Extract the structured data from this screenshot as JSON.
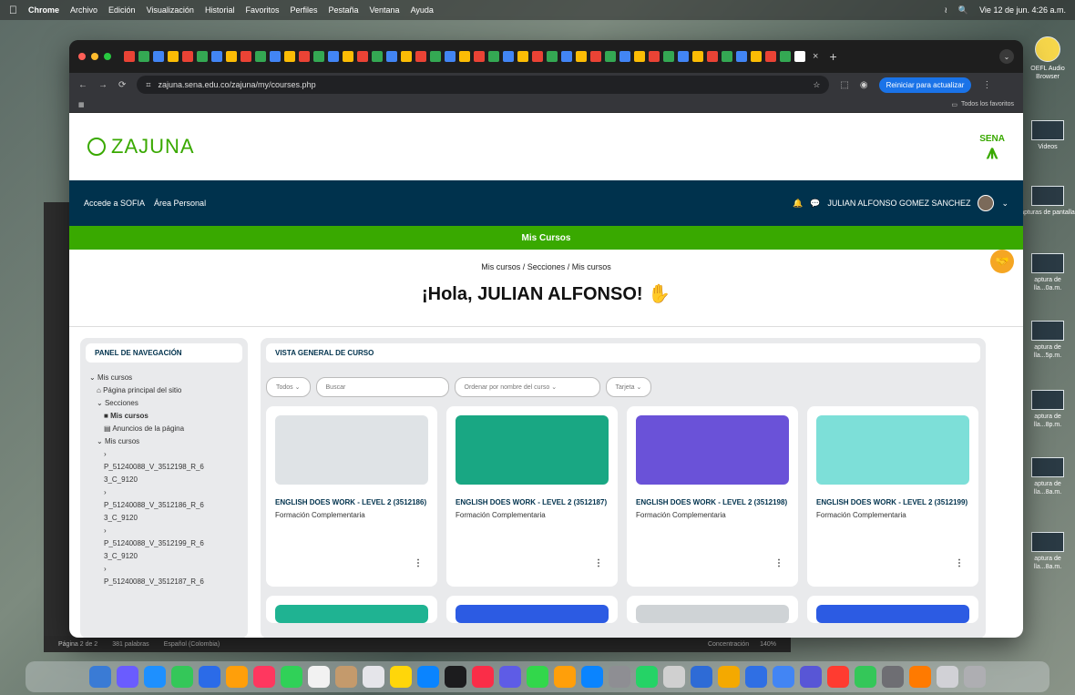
{
  "menubar": {
    "apple_icon": "apple-logo-icon",
    "items": [
      "Chrome",
      "Archivo",
      "Edición",
      "Visualización",
      "Historial",
      "Favoritos",
      "Perfiles",
      "Pestaña",
      "Ventana",
      "Ayuda"
    ],
    "datetime": "Vie 12 de jun. 4:26 a.m."
  },
  "desktop_icons": [
    {
      "label": "OEFL Audio\nBrowser"
    },
    {
      "label": "Videos"
    },
    {
      "label": "apturas de\npantalla"
    },
    {
      "label": "aptura de\nlla...0a.m."
    },
    {
      "label": "aptura de\nlla...5p.m."
    },
    {
      "label": "aptura de\nlla...8p.m."
    },
    {
      "label": "aptura de\nlla...8a.m."
    },
    {
      "label": "aptura de\nlla...8a.m."
    }
  ],
  "behind_window": {
    "status_left": "Página 2 de 2",
    "words": "381 palabras",
    "lang": "Español (Colombia)",
    "focus": "Concentración",
    "zoom": "140%"
  },
  "browser": {
    "url": "zajuna.sena.edu.co/zajuna/my/courses.php",
    "update_button": "Reiniciar para actualizar",
    "bookmarks_all": "Todos los favoritos",
    "accent": "#1a73e8"
  },
  "site": {
    "logo_text": "ZAJUNA",
    "sena_label": "SENA",
    "brand_green": "#39a900",
    "brand_navy": "#00324d",
    "nav": {
      "link1": "Accede a SOFIA",
      "link2": "Área Personal",
      "user_name": "JULIAN ALFONSO GOMEZ SANCHEZ",
      "notification_icon": "bell-icon",
      "messages_icon": "chat-icon"
    },
    "green_bar_title": "Mis Cursos",
    "breadcrumb": "Mis cursos / Secciones / Mis cursos",
    "greeting": "¡Hola, JULIAN ALFONSO!"
  },
  "nav_panel": {
    "title": "PANEL DE NAVEGACIÓN",
    "tree": [
      {
        "label": "Mis cursos",
        "level": 1
      },
      {
        "label": "Página principal del sitio",
        "level": 2
      },
      {
        "label": "Secciones",
        "level": 2
      },
      {
        "label": "Mis cursos",
        "level": 3,
        "bold": true
      },
      {
        "label": "Anuncios de la página",
        "level": 3
      },
      {
        "label": "Mis cursos",
        "level": 2
      },
      {
        "label": "P_51240088_V_3512198_R_6",
        "level": 3
      },
      {
        "label": "3_C_9120",
        "level": 3
      },
      {
        "label": "P_51240088_V_3512186_R_6",
        "level": 3
      },
      {
        "label": "3_C_9120",
        "level": 3
      },
      {
        "label": "P_51240088_V_3512199_R_6",
        "level": 3
      },
      {
        "label": "3_C_9120",
        "level": 3
      },
      {
        "label": "P_51240088_V_3512187_R_6",
        "level": 3
      }
    ]
  },
  "course_overview": {
    "title": "VISTA GENERAL DE CURSO",
    "filters": {
      "all": "Todos",
      "search_placeholder": "Buscar",
      "sort": "Ordenar por nombre del curso",
      "view": "Tarjeta"
    },
    "courses": [
      {
        "title": "ENGLISH DOES WORK - LEVEL 2 (3512186)",
        "category": "Formación Complementaria",
        "color": "#dfe3e6"
      },
      {
        "title": "ENGLISH DOES WORK - LEVEL 2 (3512187)",
        "category": "Formación Complementaria",
        "color": "#19a783"
      },
      {
        "title": "ENGLISH DOES WORK - LEVEL 2 (3512198)",
        "category": "Formación Complementaria",
        "color": "#6a52d8"
      },
      {
        "title": "ENGLISH DOES WORK - LEVEL 2 (3512199)",
        "category": "Formación Complementaria",
        "color": "#7ddfd8"
      }
    ],
    "second_row_colors": [
      "#1fb392",
      "#2c5be3",
      "#cfd3d6",
      "#2c5be3"
    ]
  }
}
